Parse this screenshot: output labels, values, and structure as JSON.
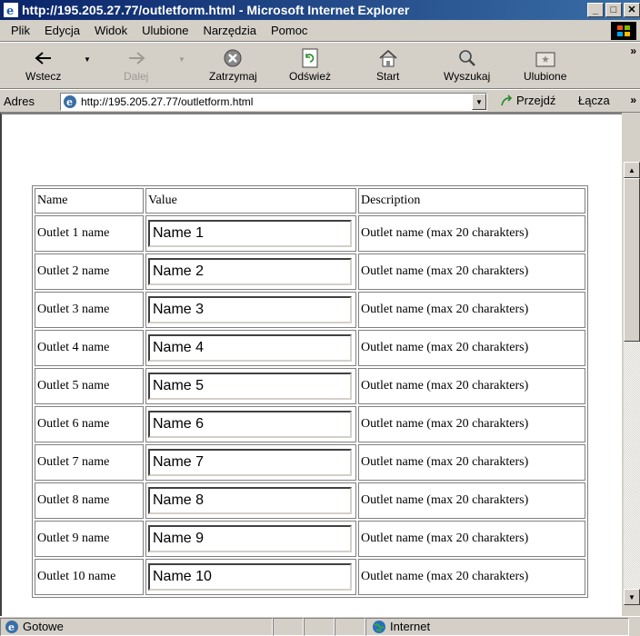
{
  "window": {
    "title": "http://195.205.27.77/outletform.html - Microsoft Internet Explorer",
    "minimize": "_",
    "maximize": "□",
    "close": "✕"
  },
  "menu": {
    "items": [
      "Plik",
      "Edycja",
      "Widok",
      "Ulubione",
      "Narzędzia",
      "Pomoc"
    ]
  },
  "toolbar": {
    "back": "Wstecz",
    "forward": "Dalej",
    "stop": "Zatrzymaj",
    "refresh": "Odśwież",
    "home": "Start",
    "search": "Wyszukaj",
    "favorites": "Ulubione",
    "more": "»"
  },
  "address": {
    "label": "Adres",
    "url": "http://195.205.27.77/outletform.html",
    "go": "Przejdź",
    "links": "Łącza",
    "more": "»"
  },
  "table": {
    "headers": [
      "Name",
      "Value",
      "Description"
    ],
    "rows": [
      {
        "name": "Outlet 1 name",
        "value": "Name 1",
        "desc": "Outlet name (max 20 charakters)"
      },
      {
        "name": "Outlet 2 name",
        "value": "Name 2",
        "desc": "Outlet name (max 20 charakters)"
      },
      {
        "name": "Outlet 3 name",
        "value": "Name 3",
        "desc": "Outlet name (max 20 charakters)"
      },
      {
        "name": "Outlet 4 name",
        "value": "Name 4",
        "desc": "Outlet name (max 20 charakters)"
      },
      {
        "name": "Outlet 5 name",
        "value": "Name 5",
        "desc": "Outlet name (max 20 charakters)"
      },
      {
        "name": "Outlet 6 name",
        "value": "Name 6",
        "desc": "Outlet name (max 20 charakters)"
      },
      {
        "name": "Outlet 7 name",
        "value": "Name 7",
        "desc": "Outlet name (max 20 charakters)"
      },
      {
        "name": "Outlet 8 name",
        "value": "Name 8",
        "desc": "Outlet name (max 20 charakters)"
      },
      {
        "name": "Outlet 9 name",
        "value": "Name 9",
        "desc": "Outlet name (max 20 charakters)"
      },
      {
        "name": "Outlet 10 name",
        "value": "Name 10",
        "desc": "Outlet name (max 20 charakters)"
      }
    ]
  },
  "status": {
    "text": "Gotowe",
    "zone": "Internet"
  },
  "colors": {
    "titlebar_start": "#0a246a",
    "titlebar_end": "#3a6ea5",
    "chrome": "#d4d0c8"
  }
}
